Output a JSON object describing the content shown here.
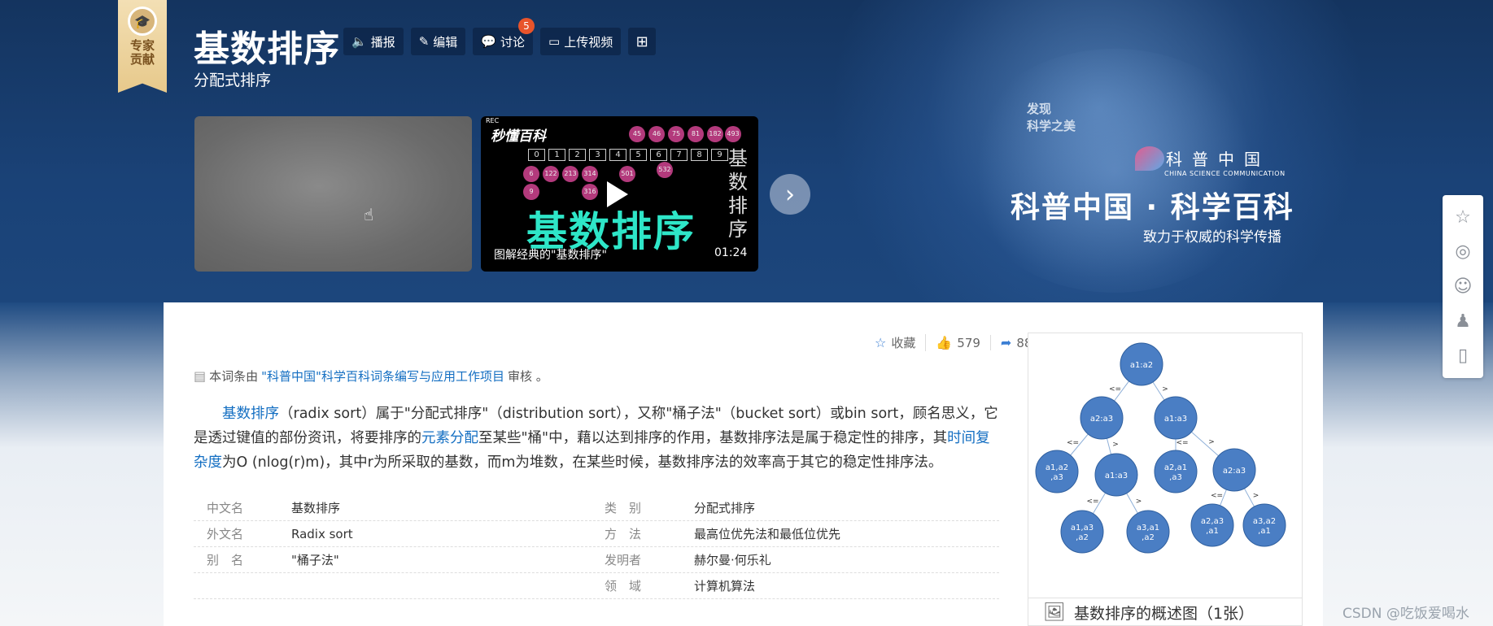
{
  "header": {
    "expert_label": "专家\n贡献",
    "title": "基数排序",
    "subtitle": "分配式排序",
    "tools": [
      {
        "icon": "speaker-icon",
        "label": "播报"
      },
      {
        "icon": "pencil-icon",
        "label": "编辑"
      },
      {
        "icon": "chat-icon",
        "label": "讨论",
        "badge": "5"
      },
      {
        "icon": "video-icon",
        "label": "上传视频"
      }
    ]
  },
  "video": {
    "brand": "秒懂百科",
    "rec": "REC",
    "big_text": "基数排序",
    "side_text": "基\n数\n排\n序",
    "digits": [
      "0",
      "1",
      "2",
      "3",
      "4",
      "5",
      "6",
      "7",
      "8",
      "9"
    ],
    "circles": [
      "45",
      "46",
      "75",
      "81",
      "182",
      "493",
      "6",
      "122",
      "213",
      "314",
      "501",
      "532",
      "9",
      "316"
    ],
    "caption": "图解经典的\"基数排序\"",
    "duration": "01:24"
  },
  "brand": {
    "discover_1": "发现",
    "discover_2": "科学之美",
    "logo_zh": "科普中国",
    "logo_en": "CHINA SCIENCE COMMUNICATION",
    "main": "科普中国 · 科学百科",
    "sub": "致力于权威的科学传播"
  },
  "stats": {
    "collect": "收藏",
    "likes": "579",
    "shares": "88"
  },
  "review": {
    "prefix": "本词条由",
    "link": "\"科普中国\"科学百科词条编写与应用工作项目",
    "suffix": "审核 。"
  },
  "intro": {
    "p1_link1": "基数排序",
    "p1_a": "（radix sort）属于\"分配式排序\"（distribution sort），又称\"桶子法\"（bucket sort）或bin sort，顾名思义，它是透过键值的部份资讯，将要排序的",
    "p1_link2": "元素分配",
    "p1_b": "至某些\"桶\"中，藉以达到排序的作用，基数排序法是属于稳定性的排序，其",
    "p1_link3": "时间复杂度",
    "p1_c": "为O (nlog(r)m)，其中r为所采取的基数，而m为堆数，在某些时候，基数排序法的效率高于其它的稳定性排序法。"
  },
  "info": {
    "rows": [
      {
        "k": "中文名",
        "v": "基数排序",
        "k2": "类　别",
        "v2": "分配式排序"
      },
      {
        "k": "外文名",
        "v": "Radix sort",
        "k2": "方　法",
        "v2": "最高位优先法和最低位优先"
      },
      {
        "k": "别　名",
        "v": "\"桶子法\"",
        "k2": "发明者",
        "v2": "赫尔曼·何乐礼"
      },
      {
        "k": "",
        "v": "",
        "k2": "领　域",
        "v2": "计算机算法"
      }
    ]
  },
  "tree": {
    "nodes": [
      "a1:a2",
      "a2:a3",
      "a1:a3",
      "a1,a2\n,a3",
      "a1:a3",
      "a2,a1\n,a3",
      "a2:a3",
      "a1,a3\n,a2",
      "a3,a1\n,a2",
      "a2,a3\n,a1",
      "a3,a2\n,a1"
    ],
    "edge_labels": [
      "<=",
      ">",
      "<=",
      ">",
      "<=",
      ">",
      "<=",
      ">",
      "<=",
      ">"
    ],
    "caption": "基数排序的概述图（1张）"
  },
  "watermark": "CSDN @吃饭爱喝水",
  "colors": {
    "banner": "#1a4277",
    "link": "#136ec2",
    "node": "#4a7ec4",
    "badge": "#e8542b"
  }
}
